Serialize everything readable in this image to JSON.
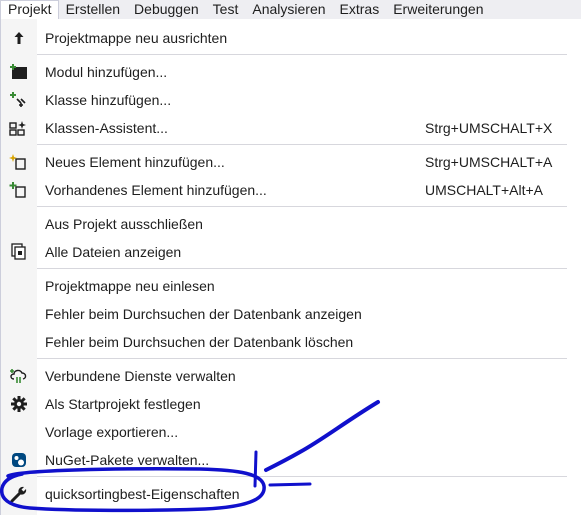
{
  "menubar": {
    "items": [
      {
        "label": "Projekt"
      },
      {
        "label": "Erstellen"
      },
      {
        "label": "Debuggen"
      },
      {
        "label": "Test"
      },
      {
        "label": "Analysieren"
      },
      {
        "label": "Extras"
      },
      {
        "label": "Erweiterungen"
      }
    ]
  },
  "menu": {
    "items": [
      {
        "label": "Projektmappe neu ausrichten",
        "shortcut": "",
        "icon": "arrow-up-icon"
      },
      {
        "label": "Modul hinzufügen...",
        "shortcut": "",
        "icon": "add-module-icon"
      },
      {
        "label": "Klasse hinzufügen...",
        "shortcut": "",
        "icon": "add-class-icon"
      },
      {
        "label": "Klassen-Assistent...",
        "shortcut": "Strg+UMSCHALT+X",
        "icon": "class-wizard-icon"
      },
      {
        "label": "Neues Element hinzufügen...",
        "shortcut": "Strg+UMSCHALT+A",
        "icon": "new-item-icon"
      },
      {
        "label": "Vorhandenes Element hinzufügen...",
        "shortcut": "UMSCHALT+Alt+A",
        "icon": "existing-item-icon"
      },
      {
        "label": "Aus Projekt ausschließen",
        "shortcut": "",
        "icon": ""
      },
      {
        "label": "Alle Dateien anzeigen",
        "shortcut": "",
        "icon": "show-all-files-icon"
      },
      {
        "label": "Projektmappe neu einlesen",
        "shortcut": "",
        "icon": ""
      },
      {
        "label": "Fehler beim Durchsuchen der Datenbank anzeigen",
        "shortcut": "",
        "icon": ""
      },
      {
        "label": "Fehler beim Durchsuchen der Datenbank löschen",
        "shortcut": "",
        "icon": ""
      },
      {
        "label": "Verbundene Dienste verwalten",
        "shortcut": "",
        "icon": "connected-services-icon"
      },
      {
        "label": "Als Startprojekt festlegen",
        "shortcut": "",
        "icon": "gear-icon"
      },
      {
        "label": "Vorlage exportieren...",
        "shortcut": "",
        "icon": ""
      },
      {
        "label": "NuGet-Pakete verwalten...",
        "shortcut": "",
        "icon": "nuget-icon"
      },
      {
        "label": "quicksortingbest-Eigenschaften",
        "shortcut": "",
        "icon": "wrench-icon"
      }
    ]
  },
  "colors": {
    "annotation": "#1010cc",
    "menubar_bg": "#eeeef2",
    "icon_gutter": "#f5f5f5"
  }
}
